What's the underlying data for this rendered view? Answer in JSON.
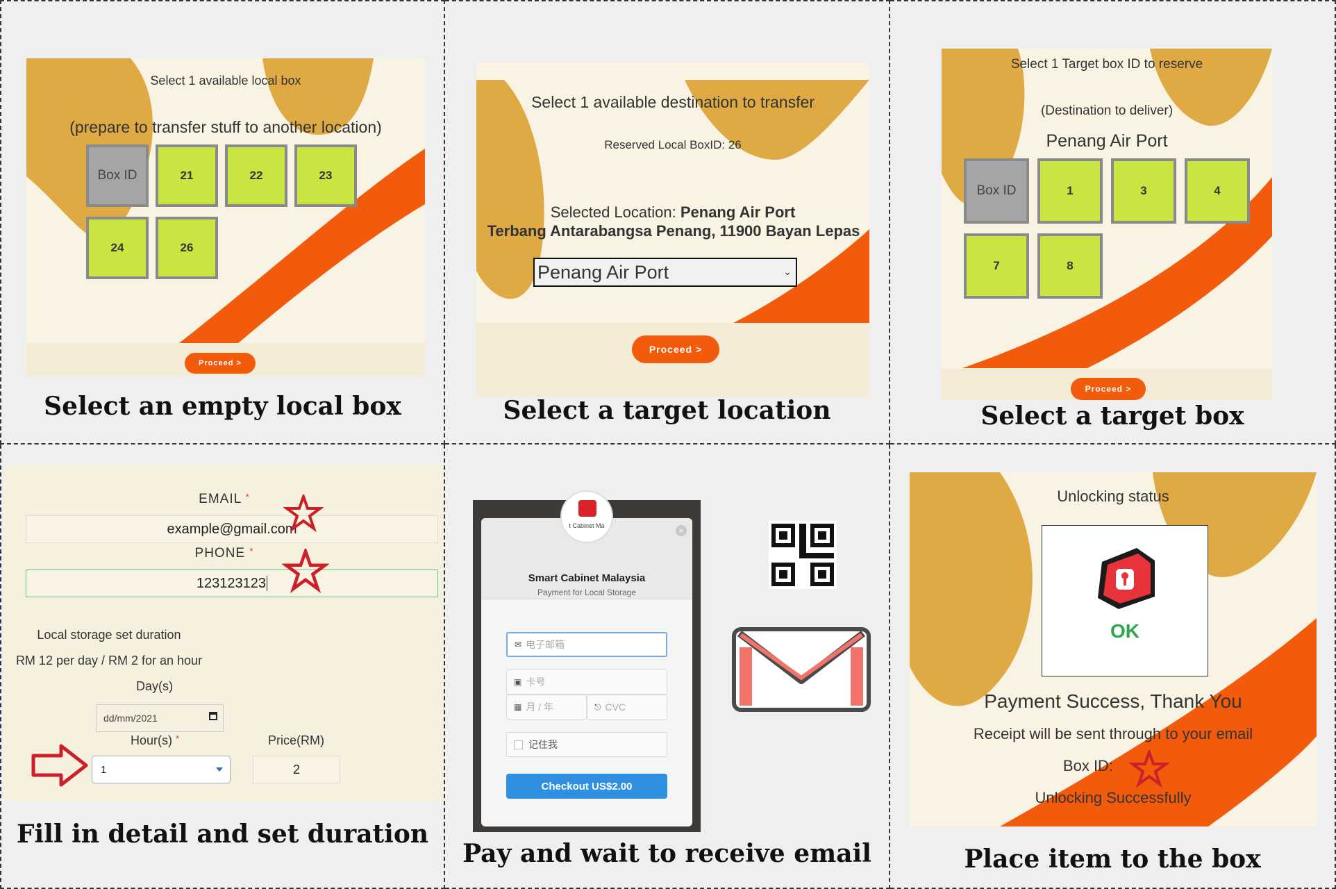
{
  "panel1": {
    "heading": "Select 1 available local box",
    "subheading": "(prepare to transfer stuff to another location)",
    "header_tile": "Box ID",
    "boxes": [
      "21",
      "22",
      "23",
      "24",
      "26"
    ],
    "button": "Proceed >",
    "caption": "Select an empty local box"
  },
  "panel2": {
    "heading": "Select 1 available destination to transfer",
    "reserved": "Reserved Local BoxID: 26",
    "selected_prefix": "Selected Location: ",
    "selected_value": "Penang Air Port",
    "address": "Terbang Antarabangsa Penang, 11900 Bayan Lepas",
    "select_value": "Penang Air Port",
    "button": "Proceed >",
    "caption": "Select a target location"
  },
  "panel3": {
    "heading": "Select 1 Target box ID to reserve",
    "subheading": "(Destination to deliver)",
    "location": "Penang Air Port",
    "header_tile": "Box ID",
    "boxes": [
      "1",
      "3",
      "4",
      "7",
      "8"
    ],
    "button": "Proceed >",
    "caption": "Select a target box"
  },
  "panel4": {
    "email_label": "EMAIL",
    "email_value": "example@gmail.com",
    "phone_label": "PHONE",
    "phone_value": "123123123",
    "duration_title": "Local storage set duration",
    "price_note": "RM 12 per day / RM 2 for an hour",
    "days_label": "Day(s)",
    "date_value": "dd/mm/2021",
    "hours_label": "Hour(s)",
    "hours_value": "1",
    "price_label": "Price(RM)",
    "price_value": "2",
    "required_mark": "*",
    "caption": "Fill in detail and set duration"
  },
  "panel5": {
    "logo_text": "t Cabinet Ma",
    "merchant": "Smart Cabinet Malaysia",
    "description": "Payment for Local Storage",
    "email_placeholder": "电子邮箱",
    "card_placeholder": "卡号",
    "expiry_placeholder": "月 / 年",
    "cvc_placeholder": "CVC",
    "remember_me": "记住我",
    "checkout": "Checkout US$2.00",
    "caption": "Pay and wait to receive email"
  },
  "panel6": {
    "heading": "Unlocking status",
    "ok": "OK",
    "success": "Payment Success, Thank You",
    "receipt": "Receipt will be sent through to your email",
    "box_id": "Box ID:",
    "unlocking": "Unlocking Successfully",
    "caption": "Place item to the box"
  },
  "colors": {
    "accent_orange": "#f25a0c",
    "mustard": "#dfa944",
    "box_green": "#c9e541",
    "cream": "#f8f3e2",
    "checkout_blue": "#2f8fe0"
  }
}
